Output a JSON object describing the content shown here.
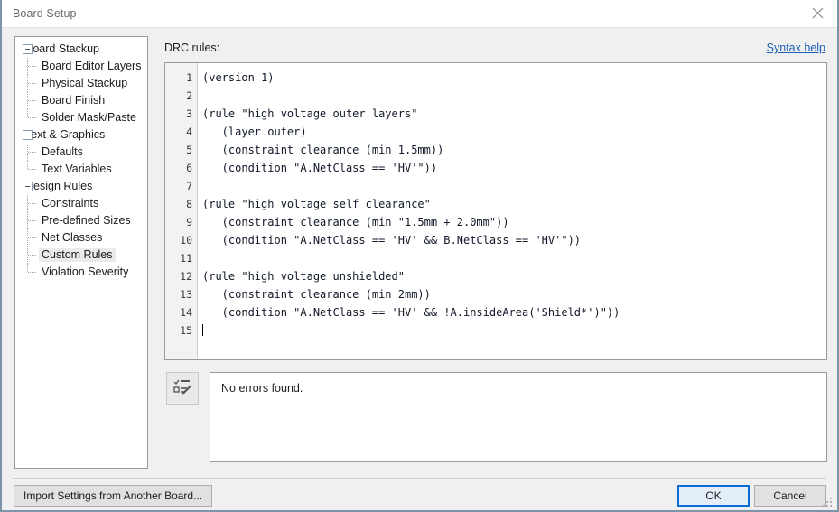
{
  "window": {
    "title": "Board Setup",
    "close_icon": "close-icon"
  },
  "sidebar": {
    "items": [
      {
        "label": "Board Stackup",
        "level": 0,
        "selected": false,
        "expandable": true
      },
      {
        "label": "Board Editor Layers",
        "level": 1,
        "selected": false,
        "expandable": false
      },
      {
        "label": "Physical Stackup",
        "level": 1,
        "selected": false,
        "expandable": false
      },
      {
        "label": "Board Finish",
        "level": 1,
        "selected": false,
        "expandable": false
      },
      {
        "label": "Solder Mask/Paste",
        "level": 1,
        "selected": false,
        "expandable": false
      },
      {
        "label": "Text & Graphics",
        "level": 0,
        "selected": false,
        "expandable": true
      },
      {
        "label": "Defaults",
        "level": 1,
        "selected": false,
        "expandable": false
      },
      {
        "label": "Text Variables",
        "level": 1,
        "selected": false,
        "expandable": false
      },
      {
        "label": "Design Rules",
        "level": 0,
        "selected": false,
        "expandable": true
      },
      {
        "label": "Constraints",
        "level": 1,
        "selected": false,
        "expandable": false
      },
      {
        "label": "Pre-defined Sizes",
        "level": 1,
        "selected": false,
        "expandable": false
      },
      {
        "label": "Net Classes",
        "level": 1,
        "selected": false,
        "expandable": false
      },
      {
        "label": "Custom Rules",
        "level": 1,
        "selected": true,
        "expandable": false
      },
      {
        "label": "Violation Severity",
        "level": 1,
        "selected": false,
        "expandable": false
      }
    ]
  },
  "main": {
    "drc_label": "DRC rules:",
    "syntax_help_label": "Syntax help",
    "editor": {
      "lines": [
        "(version 1)",
        "",
        "(rule \"high voltage outer layers\"",
        "   (layer outer)",
        "   (constraint clearance (min 1.5mm))",
        "   (condition \"A.NetClass == 'HV'\"))",
        "",
        "(rule \"high voltage self clearance\"",
        "   (constraint clearance (min \"1.5mm + 2.0mm\"))",
        "   (condition \"A.NetClass == 'HV' && B.NetClass == 'HV'\"))",
        "",
        "(rule \"high voltage unshielded\"",
        "   (constraint clearance (min 2mm))",
        "   (condition \"A.NetClass == 'HV' && !A.insideArea('Shield*')\"))",
        ""
      ],
      "line_numbers": [
        "1",
        "2",
        "3",
        "4",
        "5",
        "6",
        "7",
        "8",
        "9",
        "10",
        "11",
        "12",
        "13",
        "14",
        "15"
      ],
      "caret_line": 15
    },
    "status": {
      "check_icon": "checklist-pencil-icon",
      "message": "No errors found."
    }
  },
  "footer": {
    "import_label": "Import Settings from Another Board...",
    "ok_label": "OK",
    "cancel_label": "Cancel"
  },
  "colors": {
    "accent_link": "#1a5fb4",
    "focus_border": "#0a6cd4",
    "window_bg": "#f0f0f0",
    "panel_bg": "#ffffff"
  }
}
